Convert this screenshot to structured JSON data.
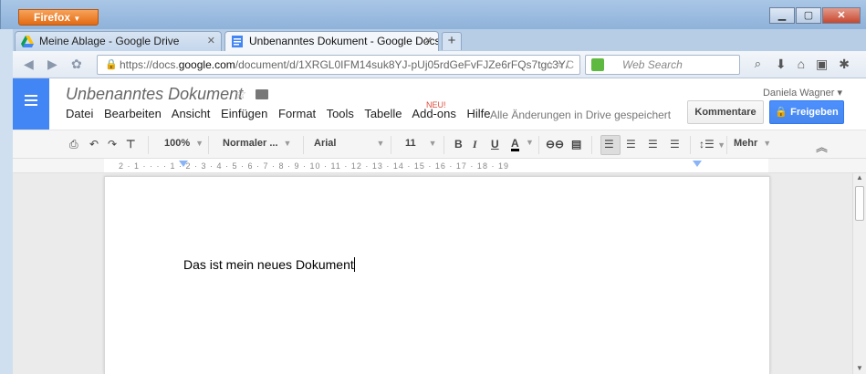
{
  "browser": {
    "app_button": "Firefox",
    "tabs": [
      {
        "label": "Meine Ablage - Google Drive",
        "active": false
      },
      {
        "label": "Unbenanntes Dokument - Google Docs",
        "active": true
      }
    ],
    "new_tab": "+",
    "url_prefix": "https://docs.",
    "url_host": "google.com",
    "url_path": "/document/d/1XRGL0IFM14suk8YJ-pUj05rdGeFvFJZe6rFQs7tgc3Y/",
    "search_placeholder": "Web Search"
  },
  "docs": {
    "title": "Unbenanntes Dokument",
    "menu": [
      "Datei",
      "Bearbeiten",
      "Ansicht",
      "Einfügen",
      "Format",
      "Tools",
      "Tabelle",
      "Add-ons",
      "Hilfe"
    ],
    "new_badge": "NEU!",
    "save_status": "Alle Änderungen in Drive gespeichert",
    "user_name": "Daniela Wagner",
    "comments_label": "Kommentare",
    "share_label": "Freigeben"
  },
  "toolbar": {
    "zoom": "100%",
    "style": "Normaler ...",
    "font": "Arial",
    "font_size": "11",
    "more_label": "Mehr"
  },
  "ruler": {
    "marks": "2 · 1 · · · · 1 · 2 · 3 · 4 · 5 · 6 · 7 · 8 · 9 · 10 · 11 · 12 · 13 · 14 · 15 · 16 · 17 · 18 · 19"
  },
  "document": {
    "body_text": "Das ist mein neues Dokument"
  }
}
